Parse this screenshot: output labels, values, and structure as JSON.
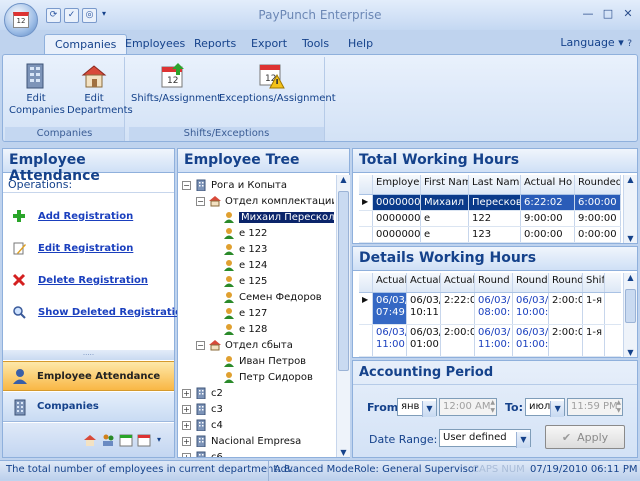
{
  "app": {
    "title": "PayPunch Enterprise"
  },
  "window_controls": [
    "—",
    "□",
    "✕"
  ],
  "menu_tabs": [
    "Companies",
    "Employees",
    "Reports",
    "Export",
    "Tools",
    "Help"
  ],
  "language": "Language",
  "ribbon": {
    "groups": [
      {
        "label": "Companies",
        "buttons": [
          {
            "label": "Edit Companies",
            "icon": "building-icon"
          },
          {
            "label": "Edit Departments",
            "icon": "department-icon"
          }
        ]
      },
      {
        "label": "Shifts/Exceptions",
        "buttons": [
          {
            "label": "Shifts/Assignment",
            "icon": "calendar-arrow-icon"
          },
          {
            "label": "Exceptions/Assignment",
            "icon": "calendar-warning-icon"
          }
        ]
      }
    ]
  },
  "left_panel": {
    "title": "Employee Attendance",
    "operations_label": "Operations:",
    "operations": [
      "Add Registration",
      "Edit Registration",
      "Delete Registration",
      "Show Deleted Registrations"
    ],
    "nav": [
      "Employee Attendance",
      "Companies"
    ]
  },
  "tree": {
    "title": "Employee Tree",
    "nodes": [
      {
        "label": "Рога и Копыта",
        "level": 0,
        "type": "company",
        "expander": "−"
      },
      {
        "label": "Отдел комплектации",
        "level": 1,
        "type": "department",
        "expander": "−"
      },
      {
        "label": "Михаил Пересколков",
        "level": 2,
        "type": "employee",
        "selected": true
      },
      {
        "label": "e 122",
        "level": 2,
        "type": "employee"
      },
      {
        "label": "e 123",
        "level": 2,
        "type": "employee"
      },
      {
        "label": "e 124",
        "level": 2,
        "type": "employee"
      },
      {
        "label": "e 125",
        "level": 2,
        "type": "employee"
      },
      {
        "label": "Семен Федоров",
        "level": 2,
        "type": "employee"
      },
      {
        "label": "e 127",
        "level": 2,
        "type": "employee"
      },
      {
        "label": "e 128",
        "level": 2,
        "type": "employee"
      },
      {
        "label": "Отдел сбыта",
        "level": 1,
        "type": "department",
        "expander": "−"
      },
      {
        "label": "Иван Петров",
        "level": 2,
        "type": "employee"
      },
      {
        "label": "Петр Сидоров",
        "level": 2,
        "type": "employee"
      },
      {
        "label": "c2",
        "level": 0,
        "type": "company",
        "expander": "+"
      },
      {
        "label": "c3",
        "level": 0,
        "type": "company",
        "expander": "+"
      },
      {
        "label": "c4",
        "level": 0,
        "type": "company",
        "expander": "+"
      },
      {
        "label": "Nacional Empresa",
        "level": 0,
        "type": "company",
        "expander": "+"
      },
      {
        "label": "c6",
        "level": 0,
        "type": "company",
        "expander": "+"
      }
    ]
  },
  "total_hours": {
    "title": "Total Working Hours",
    "columns": [
      "Employee",
      "First Name",
      "Last Name",
      "Actual Ho",
      "Rounded"
    ],
    "rows": [
      {
        "cells": [
          "00000000",
          "Михаил",
          "Пересков",
          "6:22:02",
          "6:00:00"
        ],
        "selected": true
      },
      {
        "cells": [
          "00000000",
          "e",
          "122",
          "9:00:00",
          "9:00:00"
        ]
      },
      {
        "cells": [
          "00000000",
          "e",
          "123",
          "0:00:00",
          "0:00:00"
        ]
      }
    ]
  },
  "details_hours": {
    "title": "Details Working Hours",
    "columns": [
      "Actual I",
      "Actual",
      "Actual",
      "Round",
      "Round",
      "Round",
      "Shift"
    ],
    "rows": [
      {
        "cells": [
          [
            "06/03/",
            "07:49:"
          ],
          [
            "06/03/",
            "10:11:"
          ],
          [
            "2:22:0",
            ""
          ],
          [
            "06/03/",
            "08:00:"
          ],
          [
            "06/03/",
            "10:00:"
          ],
          [
            "2:00:0",
            ""
          ],
          [
            "1-я",
            ""
          ]
        ],
        "current": true
      },
      {
        "cells": [
          [
            "06/03/",
            "11:00:"
          ],
          [
            "06/03/",
            "01:00:"
          ],
          [
            "2:00:0",
            ""
          ],
          [
            "06/03/",
            "11:00:"
          ],
          [
            "06/03/",
            "01:00:"
          ],
          [
            "2:00:0",
            ""
          ],
          [
            "1-я",
            ""
          ]
        ]
      }
    ]
  },
  "accounting": {
    "title": "Accounting Period",
    "from_label": "From:",
    "from_month": "янв",
    "from_time": "12:00 AM",
    "to_label": "To:",
    "to_month": "июл",
    "to_time": "11:59 PM",
    "range_label": "Date Range:",
    "range_value": "User defined",
    "apply_label": "Apply"
  },
  "status": {
    "message": "The total number of employees in current department: 8.",
    "mode": "Advanced Mode",
    "role": "Role: General Supervisor",
    "indicators": "CAPS NUM",
    "datetime": "07/19/2010 06:11 PM"
  },
  "colors": {
    "accent": "#15428b",
    "selection": "#0a246a",
    "nav_active": "#f9b745"
  }
}
